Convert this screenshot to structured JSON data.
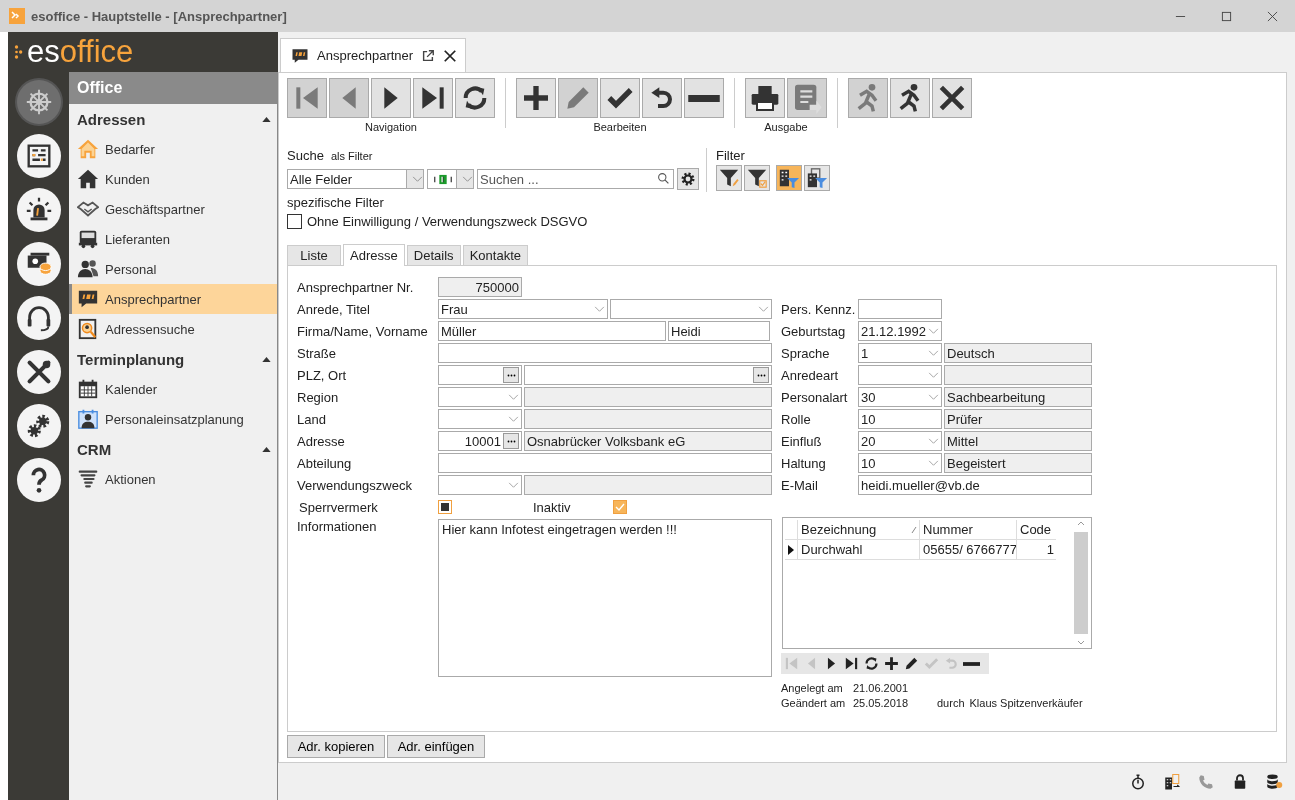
{
  "window": {
    "title": "esoffice - Hauptstelle - [Ansprechpartner]"
  },
  "logo": {
    "prefix": "es",
    "suffix": "office"
  },
  "rail": [
    {
      "kind": "wheel",
      "selected": true
    },
    {
      "kind": "planner",
      "selected": false
    },
    {
      "kind": "siren",
      "selected": false
    },
    {
      "kind": "money",
      "selected": false
    },
    {
      "kind": "headset",
      "selected": false
    },
    {
      "kind": "tools",
      "selected": false
    },
    {
      "kind": "gears",
      "selected": false
    },
    {
      "kind": "help",
      "selected": false
    }
  ],
  "sidebar": {
    "title": "Office",
    "sections": [
      {
        "title": "Adressen",
        "expanded": true,
        "items": [
          {
            "label": "Bedarfer",
            "kind": "prospect",
            "selected": false
          },
          {
            "label": "Kunden",
            "kind": "house",
            "selected": false
          },
          {
            "label": "Geschäftspartner",
            "kind": "handshake",
            "selected": false
          },
          {
            "label": "Lieferanten",
            "kind": "truck",
            "selected": false
          },
          {
            "label": "Personal",
            "kind": "people",
            "selected": false
          },
          {
            "label": "Ansprechpartner",
            "kind": "quote",
            "selected": true
          },
          {
            "label": "Adressensuche",
            "kind": "search",
            "selected": false
          }
        ]
      },
      {
        "title": "Terminplanung",
        "expanded": true,
        "items": [
          {
            "label": "Kalender",
            "kind": "calendar",
            "selected": false
          },
          {
            "label": "Personaleinsatzplanung",
            "kind": "roster",
            "selected": false
          }
        ]
      },
      {
        "title": "CRM",
        "expanded": true,
        "items": [
          {
            "label": "Aktionen",
            "kind": "tornado",
            "selected": false
          }
        ]
      }
    ]
  },
  "document_tab": {
    "title": "Ansprechpartner"
  },
  "toolbar": [
    {
      "label": "Navigation",
      "buttons": [
        {
          "kind": "first",
          "disabled": true
        },
        {
          "kind": "prev",
          "disabled": true
        },
        {
          "kind": "next",
          "disabled": false
        },
        {
          "kind": "last",
          "disabled": false
        },
        {
          "kind": "refresh",
          "disabled": false
        }
      ]
    },
    {
      "label": "Bearbeiten",
      "buttons": [
        {
          "kind": "add",
          "disabled": false
        },
        {
          "kind": "edit",
          "disabled": true
        },
        {
          "kind": "save",
          "disabled": false
        },
        {
          "kind": "undo",
          "disabled": false
        },
        {
          "kind": "delete",
          "disabled": false
        }
      ]
    },
    {
      "label": "Ausgabe",
      "buttons": [
        {
          "kind": "print",
          "disabled": false
        },
        {
          "kind": "export",
          "disabled": true
        }
      ]
    },
    {
      "buttons": [
        {
          "kind": "runback",
          "disabled": true
        },
        {
          "kind": "run",
          "disabled": false
        },
        {
          "kind": "cancel",
          "disabled": false
        }
      ]
    }
  ],
  "search": {
    "label": "Suche",
    "hint": "als Filter",
    "field": "Alle Felder",
    "placeholder": "Suchen ..."
  },
  "filter": {
    "label": "Filter",
    "buttons": [
      {
        "kind": "filteredit",
        "on": false
      },
      {
        "kind": "filtercheck",
        "on": false
      },
      {
        "kind": "building",
        "on": true
      },
      {
        "kind": "buildings",
        "on": false
      }
    ]
  },
  "specific_filter": {
    "label": "spezifische Filter",
    "options": [
      {
        "label": "Ohne Einwilligung / Verwendungszweck DSGVO",
        "checked": false
      }
    ]
  },
  "tabs": [
    {
      "label": "Liste",
      "selected": false
    },
    {
      "label": "Adresse",
      "selected": true
    },
    {
      "label": "Details",
      "selected": false
    },
    {
      "label": "Kontakte",
      "selected": false
    }
  ],
  "form_left": [
    {
      "label": "Ansprechpartner Nr.",
      "fields": [
        {
          "kind": "readonly",
          "value": "750000"
        }
      ]
    },
    {
      "label": "Anrede, Titel",
      "fields": [
        {
          "kind": "combo",
          "value": "Frau"
        },
        {
          "kind": "combo"
        }
      ]
    },
    {
      "label": "Firma/Name, Vorname",
      "fields": [
        {
          "kind": "text",
          "value": "Müller"
        },
        {
          "kind": "text",
          "value": "Heidi"
        }
      ]
    },
    {
      "label": "Straße",
      "fields": [
        {
          "kind": "text"
        }
      ]
    },
    {
      "label": "PLZ, Ort",
      "fields": [
        {
          "kind": "lookup"
        },
        {
          "kind": "lookup"
        }
      ]
    },
    {
      "label": "Region",
      "fields": [
        {
          "kind": "combo"
        },
        {
          "kind": "display"
        }
      ]
    },
    {
      "label": "Land",
      "fields": [
        {
          "kind": "combo"
        },
        {
          "kind": "display"
        }
      ]
    },
    {
      "label": "Adresse",
      "fields": [
        {
          "kind": "lookup",
          "value": "10001"
        },
        {
          "kind": "display",
          "value": "Osnabrücker Volksbank eG"
        }
      ]
    },
    {
      "label": "Abteilung",
      "fields": [
        {
          "kind": "text"
        }
      ]
    },
    {
      "label": "Verwendungszweck",
      "fields": [
        {
          "kind": "combo"
        },
        {
          "kind": "display"
        }
      ]
    }
  ],
  "checks": [
    {
      "label": "Sperrvermerk",
      "kind": "square",
      "checked": true
    },
    {
      "label": "Inaktiv",
      "kind": "tick",
      "checked": true
    }
  ],
  "information": {
    "label": "Informationen",
    "value": "Hier kann Infotest eingetragen werden !!!"
  },
  "form_right": [
    {
      "label": "Pers. Kennz.",
      "fields": [
        {
          "kind": "text"
        }
      ]
    },
    {
      "label": "Geburtstag",
      "fields": [
        {
          "kind": "combo",
          "value": "21.12.1992"
        }
      ]
    },
    {
      "label": "Sprache",
      "fields": [
        {
          "kind": "combo",
          "value": "1"
        },
        {
          "kind": "display",
          "value": "Deutsch"
        }
      ]
    },
    {
      "label": "Anredeart",
      "fields": [
        {
          "kind": "combo"
        },
        {
          "kind": "display"
        }
      ]
    },
    {
      "label": "Personalart",
      "fields": [
        {
          "kind": "combo",
          "value": "30"
        },
        {
          "kind": "display",
          "value": "Sachbearbeitung"
        }
      ]
    },
    {
      "label": "Rolle",
      "fields": [
        {
          "kind": "text",
          "value": "10"
        },
        {
          "kind": "display",
          "value": "Prüfer"
        }
      ]
    },
    {
      "label": "Einfluß",
      "fields": [
        {
          "kind": "combo",
          "value": "20"
        },
        {
          "kind": "display",
          "value": "Mittel"
        }
      ]
    },
    {
      "label": "Haltung",
      "fields": [
        {
          "kind": "combo",
          "value": "10"
        },
        {
          "kind": "display",
          "value": "Begeistert"
        }
      ]
    },
    {
      "label": "E-Mail",
      "fields": [
        {
          "kind": "text",
          "value": "heidi.mueller@vb.de"
        }
      ]
    }
  ],
  "contacts": {
    "columns": [
      {
        "label": "Bezeichnung",
        "sorted": true
      },
      {
        "label": "Nummer",
        "sorted": false
      },
      {
        "label": "Code",
        "sorted": false
      }
    ],
    "rows": [
      {
        "cells": [
          "Durchwahl",
          "05655/ 6766777",
          "1"
        ],
        "selected": true
      }
    ],
    "toolbar": [
      {
        "kind": "first",
        "disabled": true
      },
      {
        "kind": "prev",
        "disabled": true
      },
      {
        "kind": "next",
        "disabled": false
      },
      {
        "kind": "last",
        "disabled": false
      },
      {
        "kind": "refresh",
        "disabled": false
      },
      {
        "kind": "add",
        "disabled": false
      },
      {
        "kind": "edit",
        "disabled": false
      },
      {
        "kind": "save",
        "disabled": true
      },
      {
        "kind": "undo",
        "disabled": true
      },
      {
        "kind": "delete",
        "disabled": false
      }
    ]
  },
  "record": {
    "created_label": "Angelegt am",
    "created": "21.06.2001",
    "changed_label": "Geändert am",
    "changed": "25.05.2018",
    "by_label": "durch",
    "by": "Klaus Spitzenverkäufer"
  },
  "bottom_buttons": [
    "Adr. kopieren",
    "Adr. einfügen"
  ],
  "status_bar": [
    {
      "kind": "stopwatch",
      "disabled": false
    },
    {
      "kind": "building",
      "disabled": false
    },
    {
      "kind": "phone",
      "disabled": true
    },
    {
      "kind": "lock",
      "disabled": false
    },
    {
      "kind": "database",
      "disabled": false
    }
  ]
}
